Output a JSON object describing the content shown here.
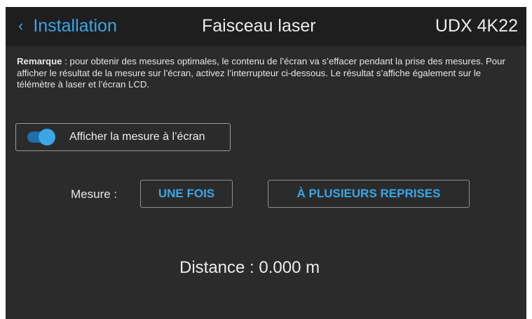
{
  "header": {
    "back_label": "Installation",
    "title": "Faisceau laser",
    "model": "UDX 4K22"
  },
  "note": {
    "prefix": "Remarque",
    "text": " : pour obtenir des mesures optimales, le contenu de l’écran va s’effacer pendant la prise des mesures. Pour afficher le résultat de la mesure sur l’écran, activez l’interrupteur ci-dessous. Le résultat s’affiche également sur le télémètre à laser et l’écran LCD."
  },
  "toggle": {
    "label": "Afficher la mesure à l’écran",
    "state": "on"
  },
  "measure": {
    "label": "Mesure :",
    "once_label": "UNE FOIS",
    "repeat_label": "À PLUSIEURS REPRISES"
  },
  "distance": {
    "label": "Distance :",
    "value": "0.000 m"
  },
  "colors": {
    "accent": "#3aa6e6",
    "background": "#2b2b2b",
    "header": "#1e1e1e"
  }
}
